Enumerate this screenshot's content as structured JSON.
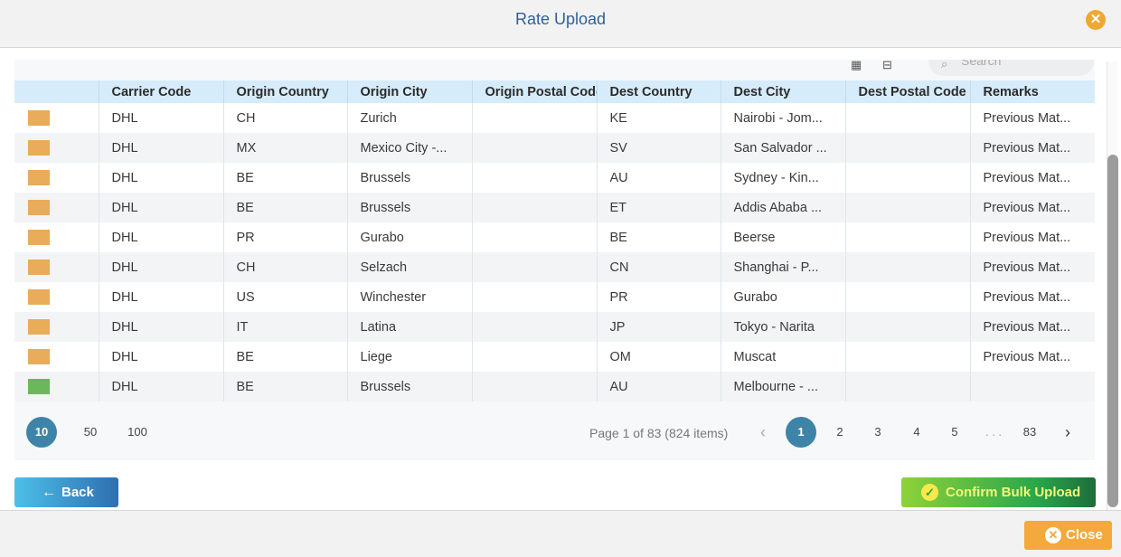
{
  "modal": {
    "title": "Rate Upload"
  },
  "icons": {
    "header_close": "close-icon",
    "search": "search-icon",
    "back": "arrow-left-icon",
    "confirm": "check-circle-icon",
    "close": "close-icon"
  },
  "colors": {
    "title": "#2f5f9e",
    "header_close": "#f0a832",
    "header_row": "#d6ecfa",
    "status_pending": "#e8ac5a",
    "status_ok": "#6ab85a",
    "pager_active": "#3d84a8",
    "close_button": "#f3a93c"
  },
  "toolbar": {
    "search_placeholder": "Search"
  },
  "table": {
    "columns": [
      "",
      "Carrier Code",
      "Origin Country",
      "Origin City",
      "Origin Postal Code",
      "Dest Country",
      "Dest City",
      "Dest Postal Code",
      "Remarks"
    ],
    "rows": [
      {
        "status": "orange",
        "carrier": "DHL",
        "origin_country": "CH",
        "origin_city": "Zurich",
        "origin_postal": "",
        "dest_country": "KE",
        "dest_city": "Nairobi - Jom...",
        "dest_postal": "",
        "remarks": "Previous Mat..."
      },
      {
        "status": "orange",
        "carrier": "DHL",
        "origin_country": "MX",
        "origin_city": "Mexico City -...",
        "origin_postal": "",
        "dest_country": "SV",
        "dest_city": "San Salvador ...",
        "dest_postal": "",
        "remarks": "Previous Mat..."
      },
      {
        "status": "orange",
        "carrier": "DHL",
        "origin_country": "BE",
        "origin_city": "Brussels",
        "origin_postal": "",
        "dest_country": "AU",
        "dest_city": "Sydney - Kin...",
        "dest_postal": "",
        "remarks": "Previous Mat..."
      },
      {
        "status": "orange",
        "carrier": "DHL",
        "origin_country": "BE",
        "origin_city": "Brussels",
        "origin_postal": "",
        "dest_country": "ET",
        "dest_city": "Addis Ababa ...",
        "dest_postal": "",
        "remarks": "Previous Mat..."
      },
      {
        "status": "orange",
        "carrier": "DHL",
        "origin_country": "PR",
        "origin_city": "Gurabo",
        "origin_postal": "",
        "dest_country": "BE",
        "dest_city": "Beerse",
        "dest_postal": "",
        "remarks": "Previous Mat..."
      },
      {
        "status": "orange",
        "carrier": "DHL",
        "origin_country": "CH",
        "origin_city": "Selzach",
        "origin_postal": "",
        "dest_country": "CN",
        "dest_city": "Shanghai - P...",
        "dest_postal": "",
        "remarks": "Previous Mat..."
      },
      {
        "status": "orange",
        "carrier": "DHL",
        "origin_country": "US",
        "origin_city": "Winchester",
        "origin_postal": "",
        "dest_country": "PR",
        "dest_city": "Gurabo",
        "dest_postal": "",
        "remarks": "Previous Mat..."
      },
      {
        "status": "orange",
        "carrier": "DHL",
        "origin_country": "IT",
        "origin_city": "Latina",
        "origin_postal": "",
        "dest_country": "JP",
        "dest_city": "Tokyo - Narita",
        "dest_postal": "",
        "remarks": "Previous Mat..."
      },
      {
        "status": "orange",
        "carrier": "DHL",
        "origin_country": "BE",
        "origin_city": "Liege",
        "origin_postal": "",
        "dest_country": "OM",
        "dest_city": "Muscat",
        "dest_postal": "",
        "remarks": "Previous Mat..."
      },
      {
        "status": "green",
        "carrier": "DHL",
        "origin_country": "BE",
        "origin_city": "Brussels",
        "origin_postal": "",
        "dest_country": "AU",
        "dest_city": "Melbourne - ...",
        "dest_postal": "",
        "remarks": ""
      }
    ]
  },
  "pager": {
    "page_sizes": [
      "10",
      "50",
      "100"
    ],
    "page_info": "Page 1 of 83 (824 items)",
    "prev": "‹",
    "pages": [
      "1",
      "2",
      "3",
      "4",
      "5"
    ],
    "ellipsis": ". . .",
    "last": "83",
    "next": "›"
  },
  "actions": {
    "back": "Back",
    "back_arrow": "←",
    "confirm": "Confirm Bulk Upload",
    "confirm_check": "✓"
  },
  "footer": {
    "close": "Close",
    "close_x": "✕"
  },
  "header": {
    "close_x": "✕"
  }
}
